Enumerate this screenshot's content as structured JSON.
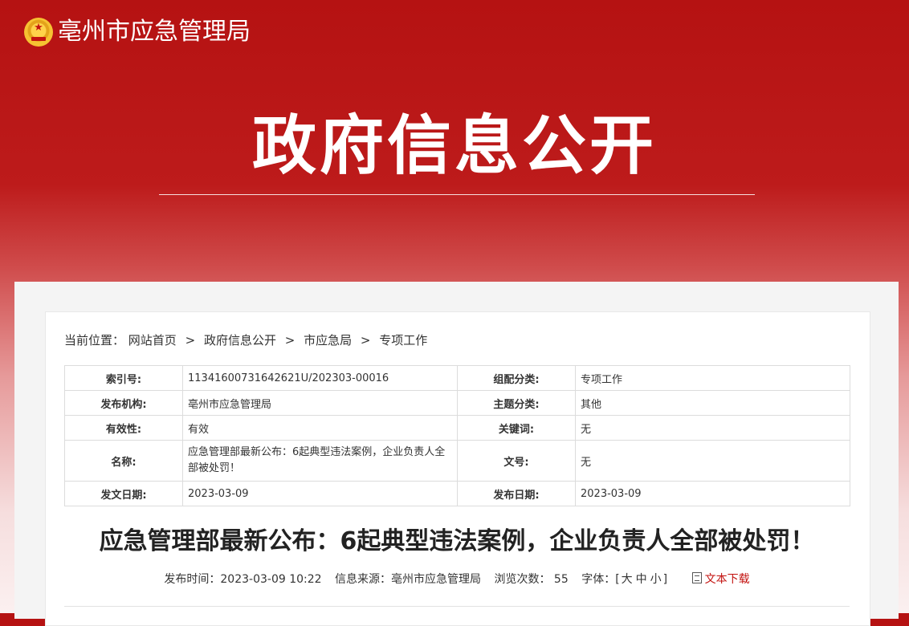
{
  "header": {
    "site_name": "亳州市应急管理局",
    "hero_title": "政府信息公开"
  },
  "breadcrumb": {
    "prefix": "当前位置：",
    "items": [
      "网站首页",
      "政府信息公开",
      "市应急局",
      "专项工作"
    ],
    "separator": ">"
  },
  "meta": {
    "index_no_label": "索引号:",
    "index_no": "11341600731642621U/202303-00016",
    "category_label": "组配分类:",
    "category": "专项工作",
    "publisher_label": "发布机构:",
    "publisher": "亳州市应急管理局",
    "topic_label": "主题分类:",
    "topic": "其他",
    "validity_label": "有效性:",
    "validity": "有效",
    "keywords_label": "关键词:",
    "keywords": "无",
    "name_label": "名称:",
    "name": "应急管理部最新公布：6起典型违法案例，企业负责人全部被处罚！",
    "doc_no_label": "文号:",
    "doc_no": "无",
    "issue_date_label": "发文日期:",
    "issue_date": "2023-03-09",
    "publish_date_label": "发布日期:",
    "publish_date": "2023-03-09"
  },
  "article": {
    "title": "应急管理部最新公布：6起典型违法案例，企业负责人全部被处罚！",
    "publish_time_label": "发布时间：",
    "publish_time": "2023-03-09 10:22",
    "source_label": "信息来源：",
    "source": "亳州市应急管理局",
    "views_label": "浏览次数：",
    "views": "55",
    "font_label": "字体：",
    "font_open": "[",
    "font_large": "大",
    "font_medium": "中",
    "font_small": "小",
    "font_close": "]",
    "download_label": "文本下载"
  },
  "colors": {
    "brand_red": "#c3120f",
    "text": "#333333"
  }
}
